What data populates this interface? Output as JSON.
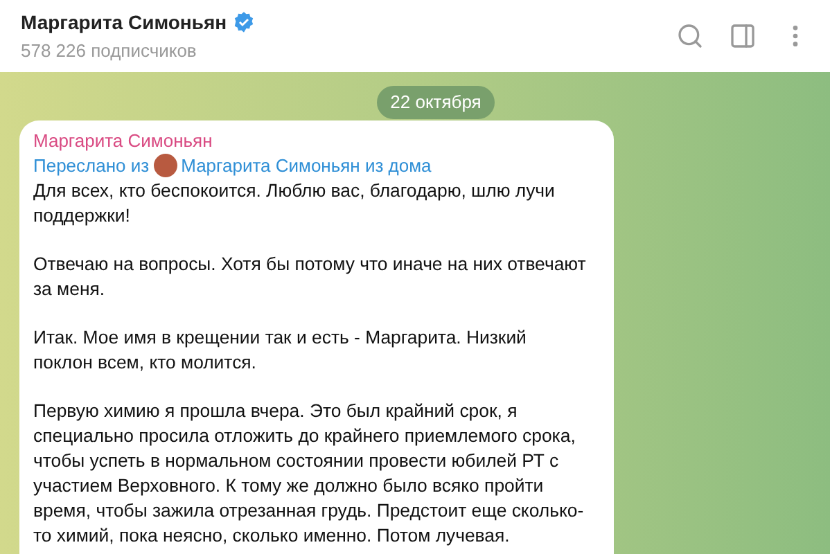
{
  "header": {
    "title": "Маргарита Симоньян",
    "verified": true,
    "subtitle": "578 226 подписчиков"
  },
  "date_pill": "22 октября",
  "message": {
    "author": "Маргарита Симоньян",
    "forwarded_prefix": "Переслано из",
    "forwarded_source": "Маргарита Симоньян из дома",
    "paragraphs": [
      "Для всех, кто беспокоится. Люблю вас, благодарю, шлю лучи поддержки!",
      "Отвечаю на вопросы. Хотя бы потому что иначе на них отвечают за меня.",
      "Итак. Мое имя в крещении так и есть - Маргарита. Низкий поклон всем, кто молится.",
      "Первую химию я прошла вчера. Это был крайний срок, я специально просила отложить до крайнего приемлемого срока, чтобы успеть в нормальном состоянии провести юбилей РТ с участием Верховного. К тому же должно было всяко пройти время, чтобы зажила отрезанная грудь. Предстоит еще сколько-то химий, пока неясно, сколько именно. Потом лучевая."
    ]
  }
}
